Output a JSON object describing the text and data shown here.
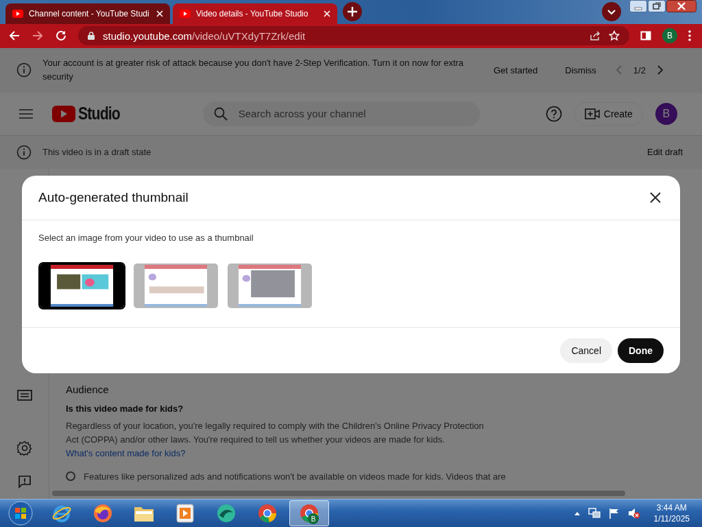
{
  "browser": {
    "tabs": [
      {
        "title": "Channel content - YouTube Studi",
        "selected": false
      },
      {
        "title": "Video details - YouTube Studio",
        "selected": true
      }
    ],
    "url": {
      "host": "studio.youtube.com",
      "path": "/video/uVTXdyT7Zrk/edit"
    },
    "profile": "B"
  },
  "banner": {
    "message": "Your account is at greater risk of attack because you don't have 2-Step Verification. Turn it on now for extra security",
    "actions": [
      "Get started",
      "Dismiss"
    ],
    "pager": "1/2"
  },
  "header": {
    "logo": "Studio",
    "search": {
      "placeholder": "Search across your channel"
    },
    "create": "Create",
    "avatar": "B"
  },
  "draft_bar": {
    "message": "This video is in a draft state",
    "action": "Edit draft"
  },
  "audience": {
    "heading": "Audience",
    "question": "Is this video made for kids?",
    "paragraph": "Regardless of your location, you're legally required to comply with the Children's Online Privacy Protection Act (COPPA) and/or other laws. You're required to tell us whether your videos are made for kids.",
    "link": "What's content made for kids?",
    "note_selected": false,
    "note": "Features like personalized ads and notifications won't be available on videos made for kids. Videos that are"
  },
  "dialog": {
    "title": "Auto-generated thumbnail",
    "subtitle": "Select an image from your video to use as a thumbnail",
    "thumbnails": [
      {
        "kind": "picture",
        "selected": true
      },
      {
        "kind": "picture",
        "selected": false
      },
      {
        "kind": "picture",
        "selected": false
      }
    ],
    "buttons": [
      {
        "label": "Cancel",
        "kind": "secondary"
      },
      {
        "label": "Done",
        "kind": "primary"
      }
    ]
  },
  "taskbar": {
    "apps": [
      {
        "kind": "start",
        "active": false
      },
      {
        "kind": "ie",
        "active": false
      },
      {
        "kind": "firefox",
        "active": false
      },
      {
        "kind": "explorer",
        "active": false
      },
      {
        "kind": "media",
        "active": false
      },
      {
        "kind": "app",
        "active": false
      },
      {
        "kind": "chrome",
        "active": false
      },
      {
        "kind": "chrome",
        "active": true,
        "badge": "B"
      }
    ],
    "time": "3:44 AM",
    "date": "1/11/2025"
  }
}
